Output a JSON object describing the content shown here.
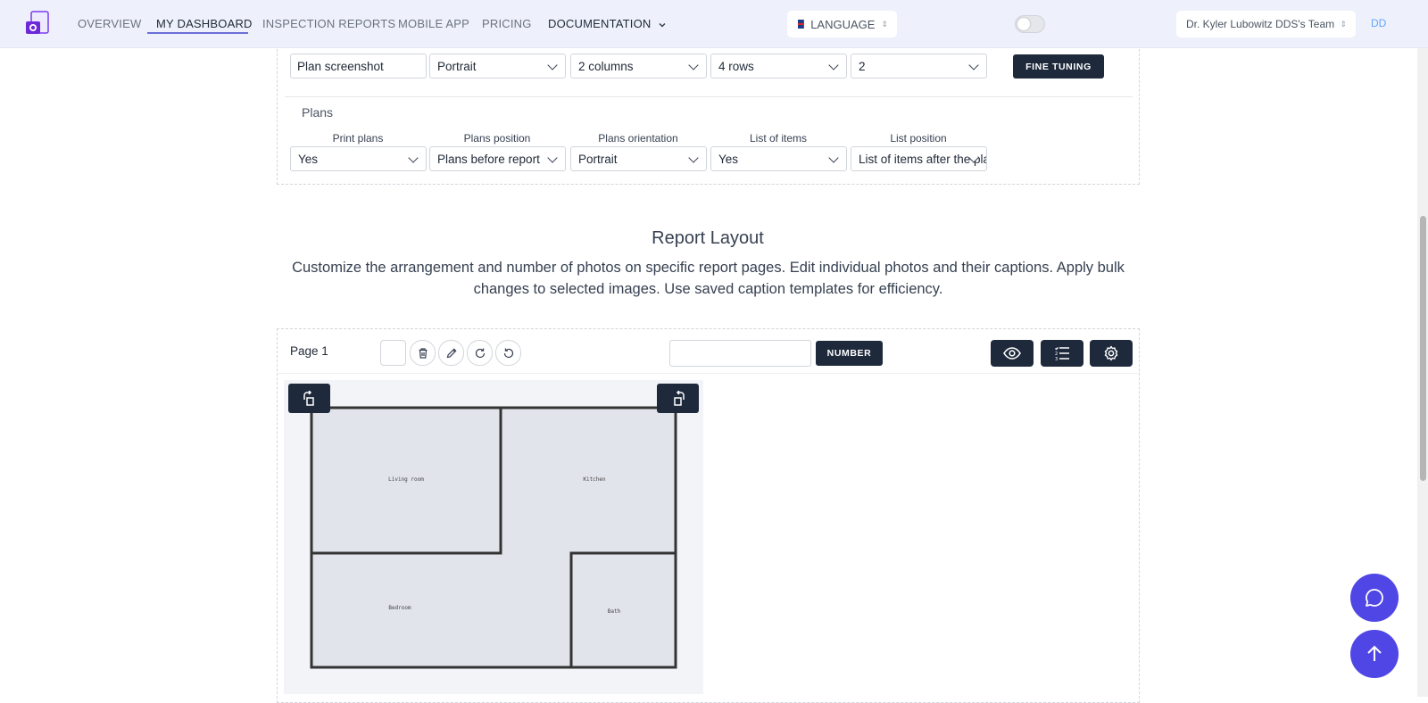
{
  "nav": {
    "links": [
      "OVERVIEW",
      "MY DASHBOARD",
      "INSPECTION REPORTS",
      "MOBILE APP",
      "PRICING",
      "DOCUMENTATION"
    ],
    "active": "MY DASHBOARD",
    "language_label": "LANGUAGE",
    "team_label": "Dr. Kyler Lubowitz DDS's Team",
    "avatar_initials": "DD"
  },
  "photo_settings": {
    "heading_value": "Plan screenshot",
    "orientation_value": "Portrait",
    "columns_value": "2 columns",
    "rows_value": "4 rows",
    "signature_height_value": "2",
    "fine_tuning_label": "FINE TUNING"
  },
  "plans": {
    "title": "Plans",
    "fields": [
      {
        "label": "Print plans",
        "value": "Yes"
      },
      {
        "label": "Plans position",
        "value": "Plans before report"
      },
      {
        "label": "Plans orientation",
        "value": "Portrait"
      },
      {
        "label": "List of items",
        "value": "Yes"
      },
      {
        "label": "List position",
        "value": "List of items after the plans"
      }
    ]
  },
  "report_layout": {
    "title": "Report Layout",
    "description": "Customize the arrangement and number of photos on specific report pages. Edit individual photos and their captions. Apply bulk changes to selected images. Use saved caption templates for efficiency."
  },
  "page": {
    "label": "Page 1",
    "number_button": "NUMBER",
    "number_input_value": ""
  },
  "floor_plan": {
    "rooms": [
      "Living room",
      "Kitchen",
      "Bedroom",
      "Bath"
    ]
  },
  "colors": {
    "accent": "#4f46e5",
    "dark_button": "#1e293b",
    "nav_bg": "#eef1fb"
  }
}
